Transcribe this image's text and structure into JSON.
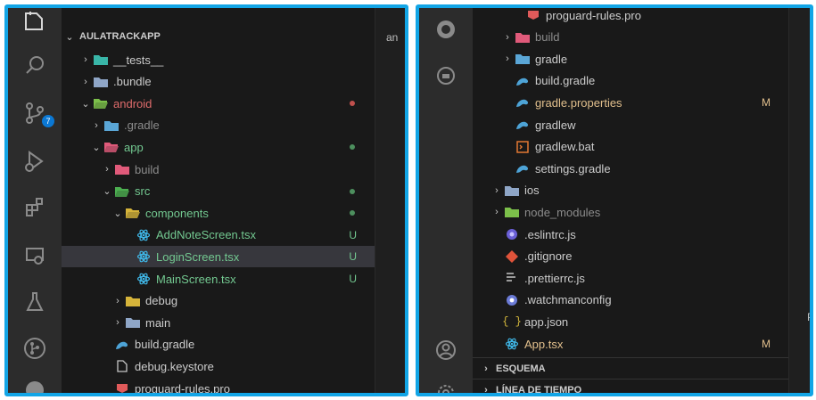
{
  "colors": {
    "frame": "#12a5e6",
    "untracked": "#73c991",
    "modified": "#e2c08d",
    "ignored": "#8c8c8c",
    "text": "#cccccc"
  },
  "left_panel": {
    "project_title": "AULATRACKAPP",
    "editor_peek": "an",
    "activity_badge": "7",
    "tree": [
      {
        "label": "__tests__"
      },
      {
        "label": ".bundle"
      },
      {
        "label": "android"
      },
      {
        "label": ".gradle"
      },
      {
        "label": "app"
      },
      {
        "label": "build"
      },
      {
        "label": "src"
      },
      {
        "label": "components"
      },
      {
        "label": "AddNoteScreen.tsx",
        "status": "U"
      },
      {
        "label": "LoginScreen.tsx",
        "status": "U"
      },
      {
        "label": "MainScreen.tsx",
        "status": "U"
      },
      {
        "label": "debug"
      },
      {
        "label": "main"
      },
      {
        "label": "build.gradle"
      },
      {
        "label": "debug.keystore"
      },
      {
        "label": "proguard-rules.pro"
      }
    ]
  },
  "right_panel": {
    "editor_peek": "P",
    "tree": [
      {
        "label": "proguard-rules.pro"
      },
      {
        "label": "build"
      },
      {
        "label": "gradle"
      },
      {
        "label": "build.gradle"
      },
      {
        "label": "gradle.properties",
        "status": "M"
      },
      {
        "label": "gradlew"
      },
      {
        "label": "gradlew.bat"
      },
      {
        "label": "settings.gradle"
      },
      {
        "label": "ios"
      },
      {
        "label": "node_modules"
      },
      {
        "label": ".eslintrc.js"
      },
      {
        "label": ".gitignore"
      },
      {
        "label": ".prettierrc.js"
      },
      {
        "label": ".watchmanconfig"
      },
      {
        "label": "app.json"
      },
      {
        "label": "App.tsx",
        "status": "M"
      }
    ],
    "sections": [
      {
        "label": "ESQUEMA"
      },
      {
        "label": "LÍNEA DE TIEMPO"
      }
    ]
  }
}
